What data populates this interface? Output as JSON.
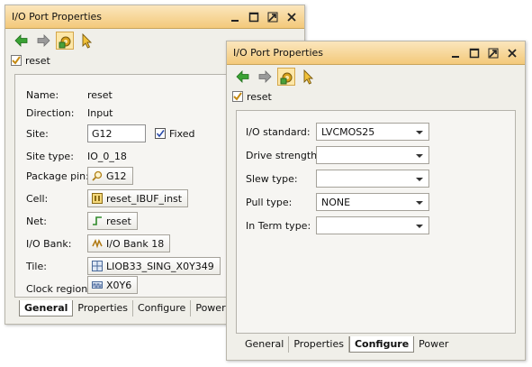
{
  "win1": {
    "title": "I/O Port Properties",
    "object_name": "reset",
    "props": {
      "name": {
        "label": "Name:",
        "value": "reset"
      },
      "direction": {
        "label": "Direction:",
        "value": "Input"
      },
      "site": {
        "label": "Site:",
        "value": "G12",
        "fixed_label": "Fixed",
        "fixed_checked": true
      },
      "site_type": {
        "label": "Site type:",
        "value": "IO_0_18"
      },
      "package_pin": {
        "label": "Package pin:",
        "value": "G12"
      },
      "cell": {
        "label": "Cell:",
        "value": "reset_IBUF_inst"
      },
      "net": {
        "label": "Net:",
        "value": "reset"
      },
      "io_bank": {
        "label": "I/O Bank:",
        "value": "I/O Bank 18"
      },
      "tile": {
        "label": "Tile:",
        "value": "LIOB33_SING_X0Y349"
      },
      "clock_region": {
        "label": "Clock region:",
        "value": "X0Y6"
      }
    },
    "tabs": [
      "General",
      "Properties",
      "Configure",
      "Power"
    ],
    "active_tab": "General"
  },
  "win2": {
    "title": "I/O Port Properties",
    "object_name": "reset",
    "config": {
      "io_standard": {
        "label": "I/O standard:",
        "value": "LVCMOS25"
      },
      "drive_strength": {
        "label": "Drive strength:",
        "value": ""
      },
      "slew_type": {
        "label": "Slew type:",
        "value": ""
      },
      "pull_type": {
        "label": "Pull type:",
        "value": "NONE"
      },
      "in_term_type": {
        "label": "In Term type:",
        "value": ""
      }
    },
    "tabs": [
      "General",
      "Properties",
      "Configure",
      "Power"
    ],
    "active_tab": "Configure"
  },
  "icons": {
    "back": "green-left-arrow-icon",
    "forward": "gray-right-arrow-icon",
    "settings": "gear-icon",
    "select": "cursor-arrow-icon",
    "object": "port-checkbox-icon"
  },
  "colors": {
    "titlebar_top": "#fbe6bd",
    "titlebar_bottom": "#f3c97a",
    "window_bg": "#f0efe9",
    "active_tab_bg": "#ffffff",
    "toolbar_highlight": "#fde7a8"
  }
}
